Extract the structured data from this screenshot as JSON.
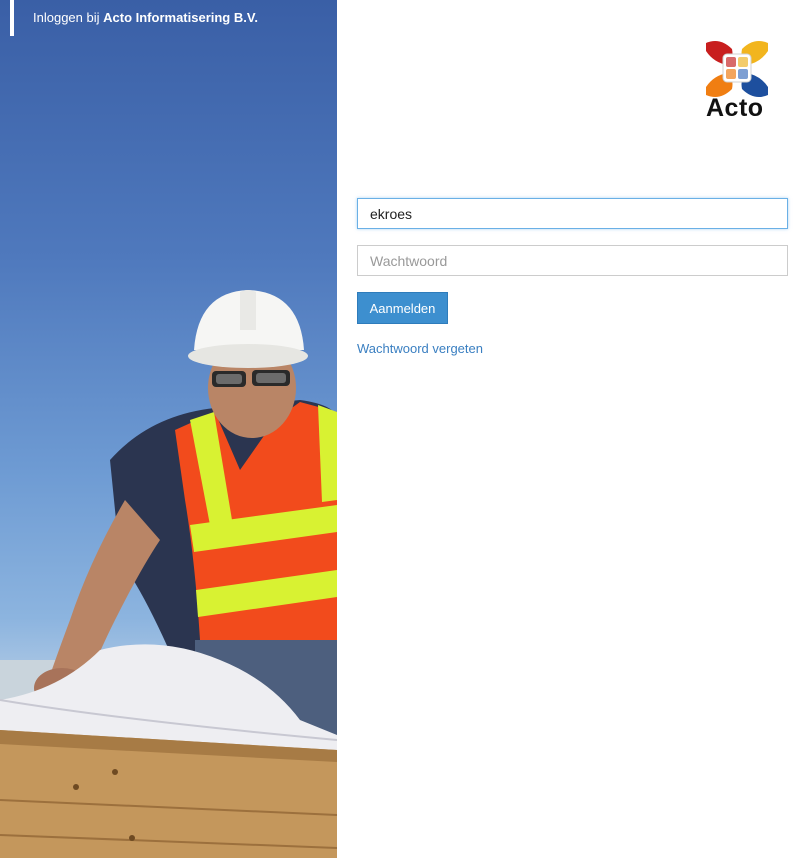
{
  "header": {
    "prefix": "Inloggen bij",
    "organization": "Acto Informatisering B.V."
  },
  "logo": {
    "text": "Acto"
  },
  "form": {
    "username_value": "ekroes",
    "password_placeholder": "Wachtwoord",
    "submit_label": "Aanmelden",
    "forgot_label": "Wachtwoord vergeten"
  },
  "colors": {
    "accent": "#3d8fcf",
    "link": "#3a7fc1",
    "focus_border": "#6ab0e6"
  }
}
